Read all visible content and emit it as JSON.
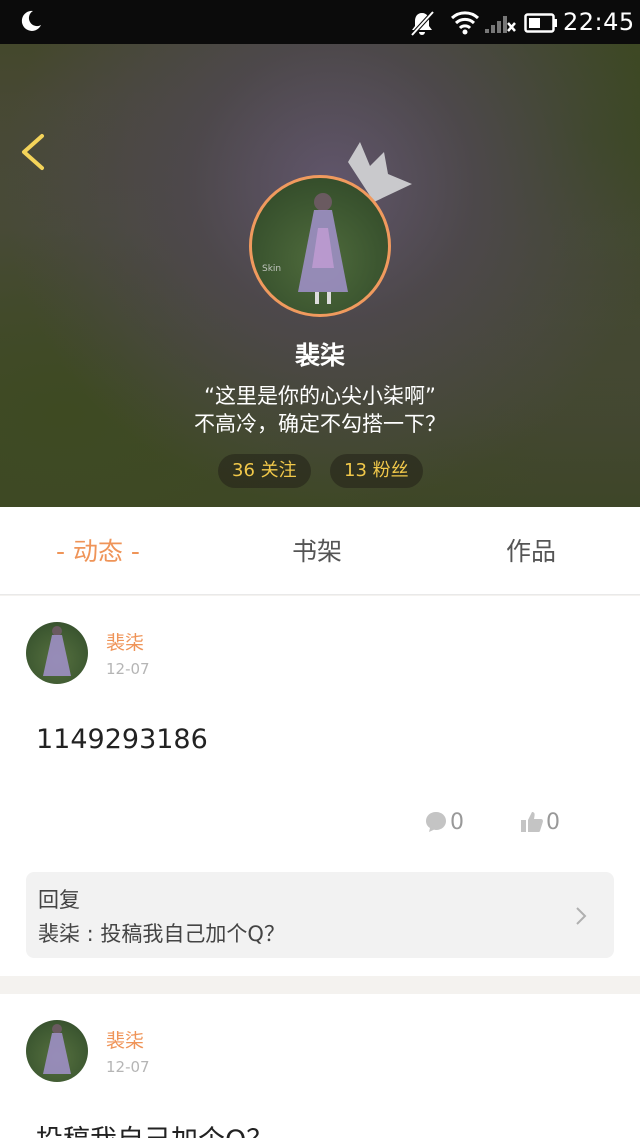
{
  "status_bar": {
    "time": "22:45",
    "icons": [
      "moon-icon",
      "mute-icon",
      "wifi-icon",
      "signal-icon",
      "battery-icon"
    ]
  },
  "profile": {
    "name": "裴柒",
    "bio_line1": "“这里是你的心尖小柒啊”",
    "bio_line2": "不高冷，确定不勾搭一下？",
    "following_label": "36 关注",
    "fans_label": "13 粉丝",
    "avatar_watermark": "Skin"
  },
  "tabs": [
    {
      "label": "- 动态 -",
      "active": true
    },
    {
      "label": "书架",
      "active": false
    },
    {
      "label": "作品",
      "active": false
    }
  ],
  "posts": [
    {
      "author": "裴柒",
      "date": "12-07",
      "text": "1149293186",
      "comments": "0",
      "likes": "0",
      "reply": {
        "title": "回复",
        "line": "裴柒 : 投稿我自己加个Q？"
      }
    },
    {
      "author": "裴柒",
      "date": "12-07",
      "text": "投稿我自己加个Q？"
    }
  ],
  "colors": {
    "accent": "#ef9458",
    "stat_text": "#f1c84a",
    "avatar_border": "#f09a5e"
  }
}
